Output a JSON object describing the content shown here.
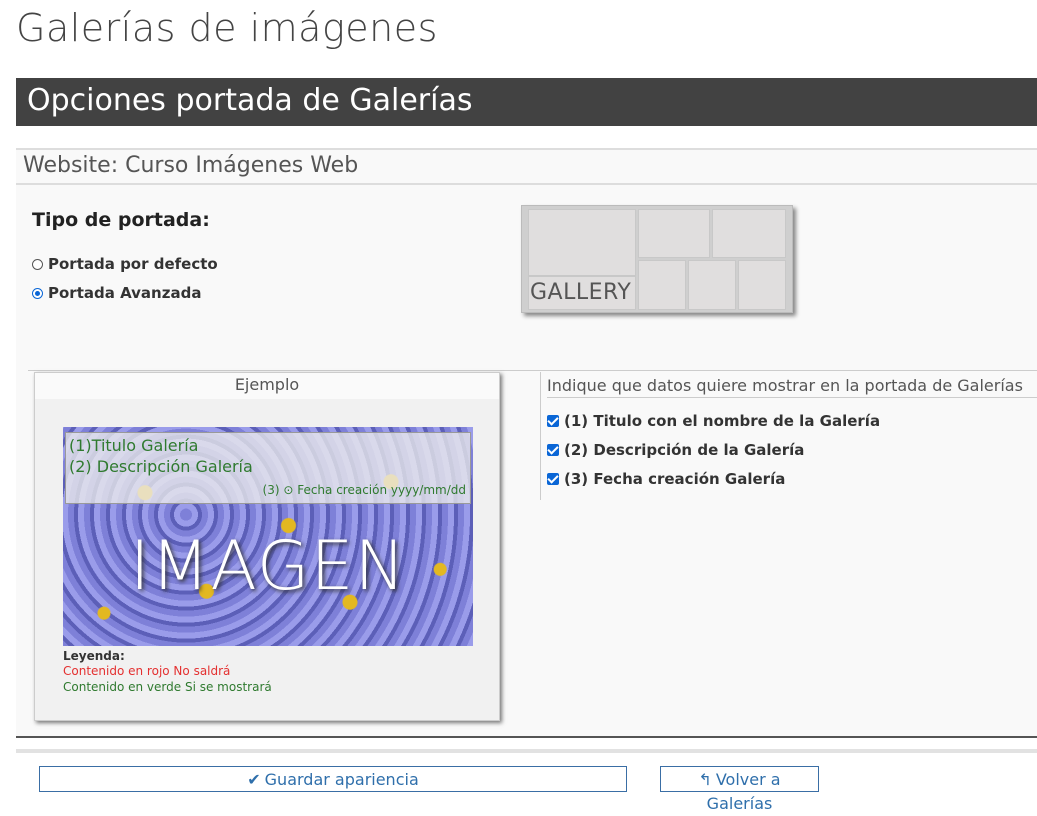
{
  "page": {
    "title": "Galerías de imágenes"
  },
  "section": {
    "header": "Opciones portada de Galerías"
  },
  "website": {
    "label": "Website: Curso Imágenes Web"
  },
  "portada": {
    "title": "Tipo de portada:",
    "options": [
      {
        "label": "Portada por defecto",
        "checked": false
      },
      {
        "label": "Portada Avanzada",
        "checked": true
      }
    ],
    "thumbnail_label": "GALLERY"
  },
  "example": {
    "title": "Ejemplo",
    "overlay_title": "(1)Titulo Galería",
    "overlay_desc": "(2) Descripción Galería",
    "overlay_date": "(3) ⊙ Fecha creación yyyy/mm/dd",
    "image_text": "IMAGEN",
    "legend_title": "Leyenda:",
    "legend_red": "Contenido en rojo No saldrá",
    "legend_green": "Contenido en verde Si se mostrará",
    "colors": {
      "red": "#e43030",
      "green": "#2f7a2f"
    }
  },
  "options": {
    "title": "Indique que datos quiere mostrar en la portada de Galerías",
    "items": [
      {
        "label": "(1) Titulo con el nombre de la Galería",
        "checked": true
      },
      {
        "label": "(2) Descripción de la Galería",
        "checked": true
      },
      {
        "label": "(3) Fecha creación Galería",
        "checked": true
      }
    ]
  },
  "buttons": {
    "save": {
      "label": "Guardar apariencia",
      "icon": "check-icon"
    },
    "back": {
      "label": "Volver a Galerías",
      "icon": "reply-icon"
    }
  },
  "colors": {
    "header_bg": "#424242",
    "accent": "#0a66d6",
    "button_text": "#2f6fab"
  }
}
